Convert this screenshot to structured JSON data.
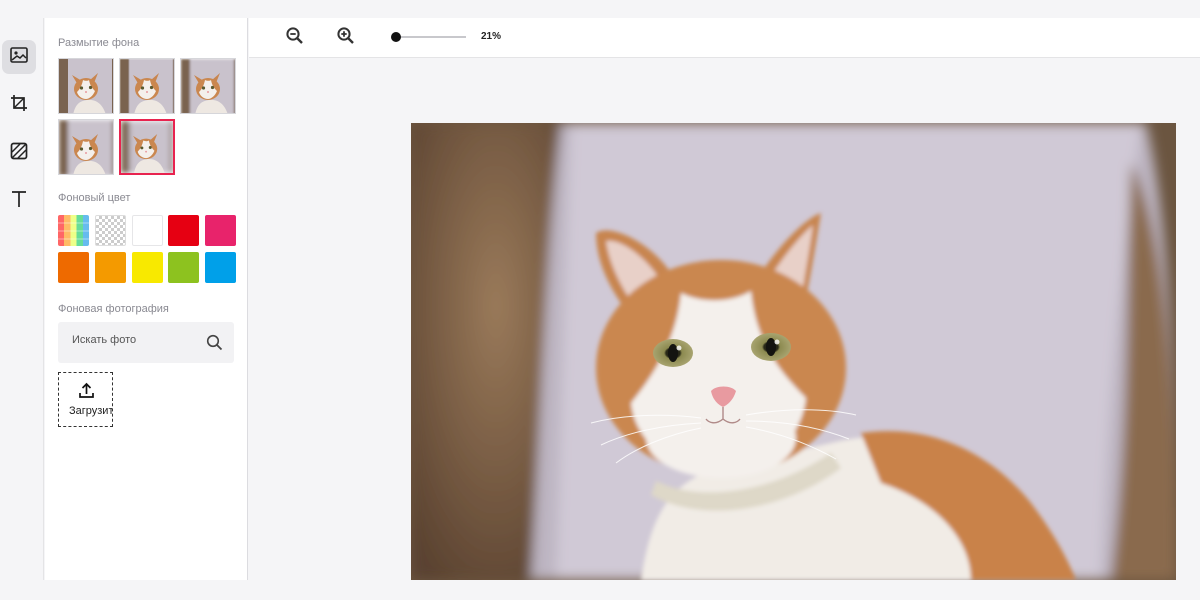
{
  "sidebar": {
    "tools": [
      {
        "icon": "image-icon",
        "active": true
      },
      {
        "icon": "crop-icon",
        "active": false
      },
      {
        "icon": "pattern-icon",
        "active": false
      },
      {
        "icon": "text-icon",
        "active": false
      }
    ],
    "blur_section": {
      "label": "Размытие фона",
      "selected_index": 4
    },
    "color_section": {
      "label": "Фоновый цвет",
      "colors": [
        "multicolor",
        "transparent",
        "#ffffff",
        "#e60012",
        "#e8236b",
        "#ee6a00",
        "#f49a00",
        "#f8e900",
        "#8dc21f",
        "#00a0e9"
      ]
    },
    "photo_section": {
      "label": "Фоновая фотография",
      "search_placeholder": "Искать фото",
      "upload_label": "Загрузит"
    }
  },
  "toolbar": {
    "zoom_out_icon": "zoom-out-icon",
    "zoom_in_icon": "zoom-in-icon",
    "zoom_value": "21%",
    "zoom_level": 0.0
  }
}
